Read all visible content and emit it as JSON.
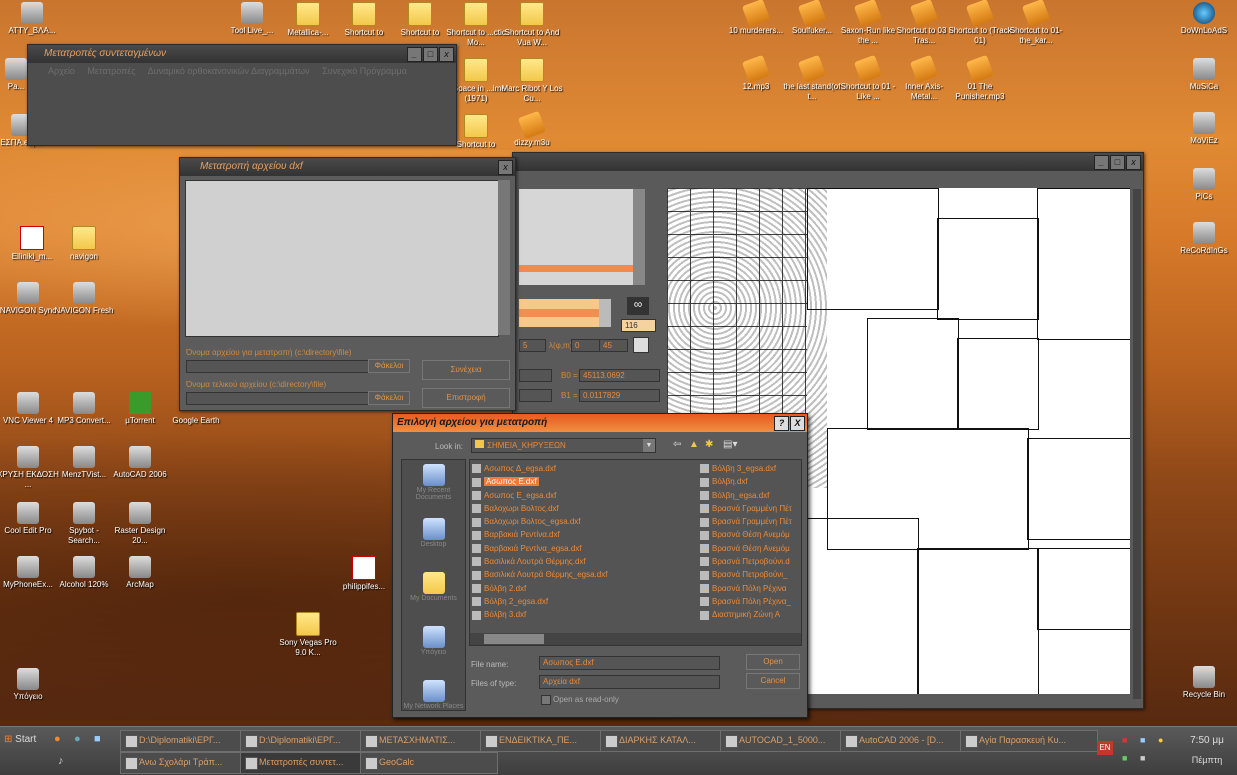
{
  "desktop_icons": [
    {
      "label": "ΑΤΤΥ_ΒΛΑ...",
      "kind": "file-icon"
    },
    {
      "label": "Pa...",
      "kind": "app-icon"
    },
    {
      "label": "ΕΣΠΑ.esp...",
      "kind": "app-icon"
    },
    {
      "label": "Elliniki_m...",
      "kind": "pdf-icon"
    },
    {
      "label": "navigon",
      "kind": "folder-icon"
    },
    {
      "label": "NAVIGON Sync",
      "kind": "app-icon"
    },
    {
      "label": "NAVIGON Fresh",
      "kind": "app-icon"
    },
    {
      "label": "VNC Viewer 4",
      "kind": "app-icon"
    },
    {
      "label": "MP3 Convert...",
      "kind": "app-icon"
    },
    {
      "label": "µTorrent",
      "kind": "app-icon"
    },
    {
      "label": "Google Earth",
      "kind": "app-icon"
    },
    {
      "label": "ΧΡΥΣΗ ΕΚΔΟΣΗ ...",
      "kind": "app-icon"
    },
    {
      "label": "MenzTVist...",
      "kind": "app-icon"
    },
    {
      "label": "AutoCAD 2006",
      "kind": "app-icon"
    },
    {
      "label": "Cool Edit Pro",
      "kind": "app-icon"
    },
    {
      "label": "Spybot - Search...",
      "kind": "app-icon"
    },
    {
      "label": "Raster Design 20...",
      "kind": "app-icon"
    },
    {
      "label": "MyPhoneEx...",
      "kind": "app-icon"
    },
    {
      "label": "Alcohol 120%",
      "kind": "app-icon"
    },
    {
      "label": "ArcMap",
      "kind": "app-icon"
    },
    {
      "label": "philippifes...",
      "kind": "pdf-icon"
    },
    {
      "label": "Sony Vegas Pro 9.0 K...",
      "kind": "folder-icon"
    },
    {
      "label": "Υπόγειο",
      "kind": "app-icon"
    },
    {
      "label": "Tool Live_...",
      "kind": "app-icon"
    },
    {
      "label": "Metallica-...",
      "kind": "folder-icon"
    },
    {
      "label": "Shortcut to",
      "kind": "folder-icon"
    },
    {
      "label": "Shortcut to",
      "kind": "folder-icon"
    },
    {
      "label": "Shortcut to ...ctic Mo...",
      "kind": "folder-icon"
    },
    {
      "label": "Shortcut to And Vua W...",
      "kind": "folder-icon"
    },
    {
      "label": "...Space in ...ime (1971)",
      "kind": "folder-icon"
    },
    {
      "label": "Marc Ribot Y Los Cu...",
      "kind": "folder-icon"
    },
    {
      "label": "Shortcut to",
      "kind": "folder-icon"
    },
    {
      "label": "dizzy.m3u",
      "kind": "file-icon"
    },
    {
      "label": "10 murderers...",
      "kind": "shortcut-icon"
    },
    {
      "label": "Soulfuker...",
      "kind": "shortcut-icon"
    },
    {
      "label": "Saxon-Run like the ...",
      "kind": "shortcut-icon"
    },
    {
      "label": "Shortcut to 03 - Tras...",
      "kind": "shortcut-icon"
    },
    {
      "label": "Shortcut to (Track 01)",
      "kind": "shortcut-icon"
    },
    {
      "label": "Shortcut to 01-the_kar...",
      "kind": "shortcut-icon"
    },
    {
      "label": "12.mp3",
      "kind": "shortcut-icon"
    },
    {
      "label": "the last stand(of t...",
      "kind": "shortcut-icon"
    },
    {
      "label": "Shortcut to 01 - Like ...",
      "kind": "shortcut-icon"
    },
    {
      "label": "Inner Axis-Metal...",
      "kind": "shortcut-icon"
    },
    {
      "label": "01 The Punisher.mp3",
      "kind": "shortcut-icon"
    },
    {
      "label": "DoWnLoAdS",
      "kind": "app-icon"
    },
    {
      "label": "MuSiCa",
      "kind": "app-icon"
    },
    {
      "label": "MoViEz",
      "kind": "app-icon"
    },
    {
      "label": "PiCs",
      "kind": "app-icon"
    },
    {
      "label": "ReCoRdInGs",
      "kind": "app-icon"
    },
    {
      "label": "Recycle Bin",
      "kind": "app-icon"
    }
  ],
  "win_coords": {
    "title": "Μετατροπές συντεταγμένων",
    "menu": [
      "Αρχείο",
      "Μετατροπές",
      "Δυναμικό ορθοκανονικών Διαγραμμάτων",
      "Συνεχικό Πρόγραμμα"
    ]
  },
  "win_dxf": {
    "title": "Μετατροπή αρχείου dxf",
    "label_input": "Όνομα αρχείου για μετατροπή (c:\\directory\\file)",
    "label_output": "Όνομα τελικού αρχείου (c:\\directory\\file)",
    "browse1": "Φάκελοι",
    "browse2": "Φάκελοι",
    "continue": "Συνέχεια",
    "back": "Επιστροφή"
  },
  "geo_panel": {
    "field_116": "116",
    "field_5": "5",
    "label_lambda": "λ(φ,m)",
    "field_0": "0",
    "field_45": "45",
    "label_b0": "B0 =",
    "b0": "45113.0692",
    "label_b1": "B1 =",
    "b1": "0.0117829"
  },
  "open_dialog": {
    "title": "Επιλογή αρχείου για μετατροπή",
    "help": "?",
    "close": "X",
    "look_in_label": "Look in:",
    "look_in_value": "ΣΗΜΕΙΑ_ΚΗΡΥΞΕΩΝ",
    "places": [
      "My Recent Documents",
      "Desktop",
      "My Documents",
      "Υπόγειο",
      "My Network Places"
    ],
    "col1": [
      "Ασωπος Δ_egsa.dxf",
      "Ασωπος Ε.dxf",
      "Ασωπος Ε_egsa.dxf",
      "Βαλοχωρι Βολτος.dxf",
      "Βαλοχωρι Βολτος_egsa.dxf",
      "Βαρβακιά Ρεντίνα.dxf",
      "Βαρβακιά Ρεντίνα_egsa.dxf",
      "Βασιλικά Λουτρά Θέρμης.dxf",
      "Βασιλικά Λουτρά Θέρμης_egsa.dxf",
      "Βόλβη 2.dxf",
      "Βόλβη 2_egsa.dxf",
      "Βόλβη 3.dxf"
    ],
    "col2": [
      "Βόλβη 3_egsa.dxf",
      "Βόλβη.dxf",
      "Βόλβη_egsa.dxf",
      "Βρασνά Γραμμένη Πέτ",
      "Βρασνά Γραμμένη Πέτ",
      "Βρασνά Θέση Ανεμόμ",
      "Βρασνά Θέση Ανεμόμ",
      "Βρασνά Πετροβούνι.d",
      "Βρασνά Πετροβούνι_",
      "Βρασνά Πόλη Ρέχινα",
      "Βρασνά Πόλη Ρέχινα_",
      "Διαστημική Ζώνη Α"
    ],
    "selected_index": 1,
    "file_name_label": "File name:",
    "file_name_value": "Ασωπος Ε.dxf",
    "files_of_type_label": "Files of type:",
    "files_of_type_value": "Αρχεία dxf",
    "read_only": "Open as read-only",
    "open": "Open",
    "cancel": "Cancel"
  },
  "taskbar": {
    "start": "Start",
    "row1": [
      "D:\\Diplomatiki\\ΕΡΓ...",
      "D:\\Diplomatiki\\ΕΡΓ...",
      "ΜΕΤΑΣΧΗΜΑΤΙΣ...",
      "ΕΝΔΕΙΚΤΙΚΑ_ΠΕ...",
      "ΔΙΑΡΚΗΣ ΚΑΤΑΛ...",
      "AUTOCAD_1_5000...",
      "AutoCAD 2006 - [D...",
      "Αγία Παρασκευή Κυ..."
    ],
    "row2": [
      "Άνω Σχολάρι Τράπ...",
      "Μετατροπές συντετ...",
      "GeoCalc"
    ],
    "lang": "EN",
    "time": "7:50 μμ",
    "day": "Πέμπτη"
  },
  "colors": {
    "accent": "#e8823a",
    "title_text": "#e8a060"
  }
}
